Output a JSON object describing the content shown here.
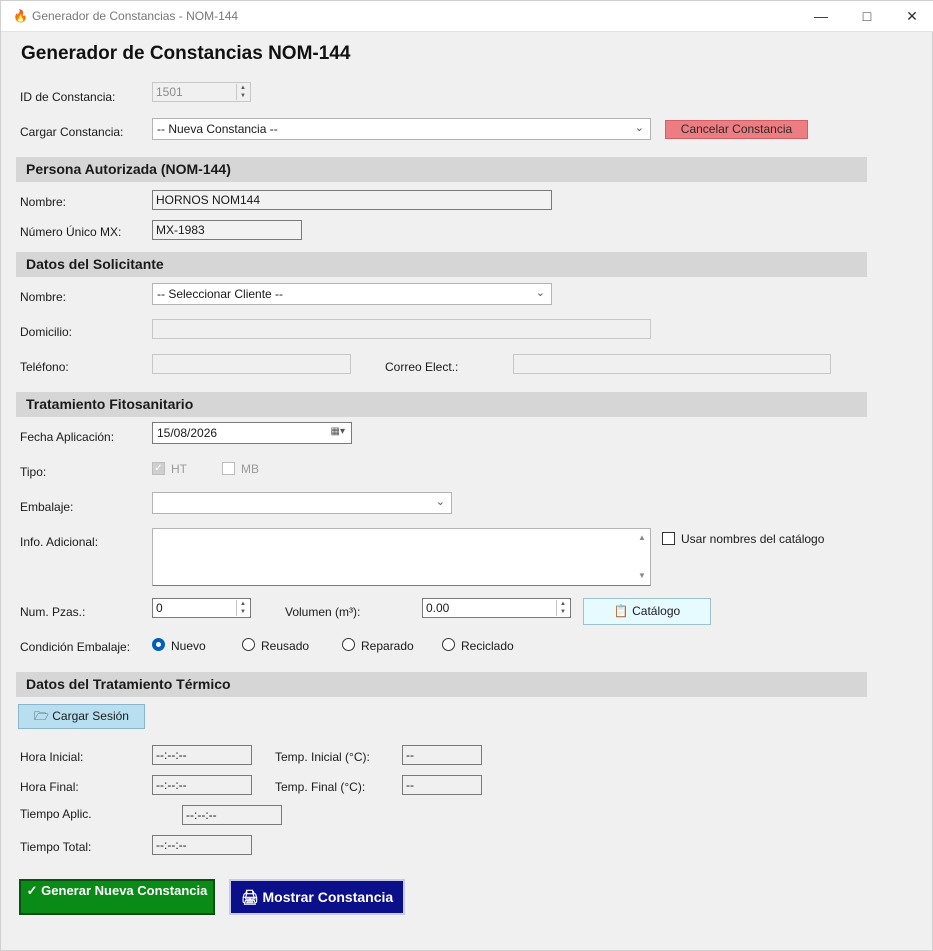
{
  "window": {
    "title": "Generador de Constancias - NOM-144",
    "minimize_icon": "minimize-icon",
    "maximize_icon": "maximize-icon",
    "close_icon": "close-icon"
  },
  "heading": "Generador de Constancias NOM-144",
  "constancia": {
    "id_label": "ID de Constancia:",
    "id_value": "1501",
    "cargar_label": "Cargar Constancia:",
    "cargar_selected": "-- Nueva Constancia --",
    "cancel_label": "Cancelar Constancia"
  },
  "persona": {
    "section_title": "Persona Autorizada (NOM-144)",
    "nombre_label": "Nombre:",
    "nombre_value": "HORNOS NOM144",
    "numero_label": "Número Único MX:",
    "numero_value": "MX-1983"
  },
  "solicitante": {
    "section_title": "Datos del Solicitante",
    "nombre_label": "Nombre:",
    "nombre_selected": "-- Seleccionar Cliente --",
    "domicilio_label": "Domicilio:",
    "domicilio_value": "",
    "telefono_label": "Teléfono:",
    "telefono_value": "",
    "correo_label": "Correo Elect.:",
    "correo_value": ""
  },
  "tratamiento": {
    "section_title": "Tratamiento Fitosanitario",
    "fecha_label": "Fecha Aplicación:",
    "fecha_value": "15/08/2026",
    "tipo_label": "Tipo:",
    "tipo_ht": "HT",
    "tipo_mb": "MB",
    "embalaje_label": "Embalaje:",
    "embalaje_selected": "",
    "info_label": "Info. Adicional:",
    "info_value": "",
    "usar_nombres_label": "Usar nombres del catálogo",
    "num_pzas_label": "Num. Pzas.:",
    "num_pzas_value": "0",
    "volumen_label": "Volumen (m³):",
    "volumen_value": "0.00",
    "catalogo_label": "Catálogo",
    "condicion_label": "Condición Embalaje:",
    "condicion_options": [
      "Nuevo",
      "Reusado",
      "Reparado",
      "Reciclado"
    ],
    "condicion_selected": "Nuevo"
  },
  "termico": {
    "section_title": "Datos del Tratamiento Térmico",
    "cargar_sesion_label": "Cargar Sesión",
    "hora_inicial_label": "Hora Inicial:",
    "hora_inicial_value": "--:--:--",
    "temp_inicial_label": "Temp. Inicial (°C):",
    "temp_inicial_value": "--",
    "hora_final_label": "Hora Final:",
    "hora_final_value": "--:--:--",
    "temp_final_label": "Temp. Final (°C):",
    "temp_final_value": "--",
    "tiempo_aplic_label": "Tiempo Aplic.",
    "tiempo_aplic_value": "--:--:--",
    "tiempo_total_label": "Tiempo Total:",
    "tiempo_total_value": "--:--:--"
  },
  "actions": {
    "generar_label": "✓ Generar Nueva Constancia",
    "mostrar_label": "Mostrar Constancia"
  },
  "colors": {
    "cancel": "#ec7d82",
    "generar": "#0a8a16",
    "mostrar": "#0b0f8a",
    "catalogo": "#e6fbff",
    "sesion": "#b8dff0"
  }
}
